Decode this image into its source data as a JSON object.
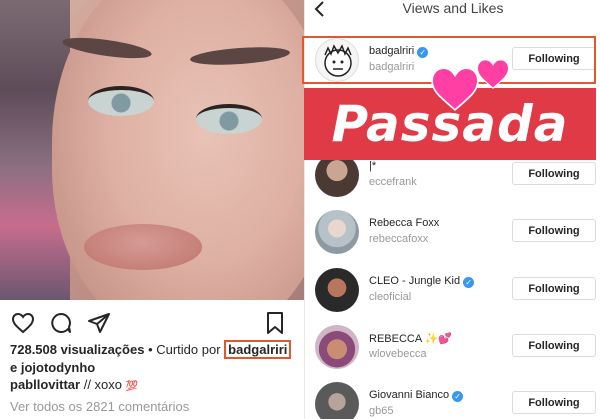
{
  "post": {
    "likes_count": "728.508 visualizações",
    "liked_by_prefix": "• Curtido por",
    "liked_by_user": "badgalriri",
    "liked_by_more": "e jojotodynho",
    "caption_user": "pabllovittar",
    "caption_text": "// xoxo",
    "caption_emoji": "💯",
    "view_comments": "Ver todos os 2821 comentários"
  },
  "panel": {
    "title": "Views and Likes",
    "banner_text": "Passada",
    "users": [
      {
        "username": "badgalriri",
        "fullname": "badgalriri",
        "verified": true,
        "button": "Following"
      },
      {
        "username": "|*",
        "fullname": "eccefrank",
        "verified": false,
        "button": "Following"
      },
      {
        "username": "Rebecca Foxx",
        "fullname": "rebeccafoxx",
        "verified": false,
        "button": "Following"
      },
      {
        "username": "CLEO - Jungle Kid",
        "fullname": "cleoficial",
        "verified": true,
        "button": "Following"
      },
      {
        "username": "REBECCA ✨💕",
        "fullname": "wlovebecca",
        "verified": false,
        "button": "Following"
      },
      {
        "username": "Giovanni Bianco",
        "fullname": "gb65",
        "verified": true,
        "button": "Following"
      }
    ]
  },
  "colors": {
    "highlight": "#e2582b",
    "banner": "#e13a47",
    "verified": "#3897f0",
    "heart": "#ff3fa4"
  }
}
